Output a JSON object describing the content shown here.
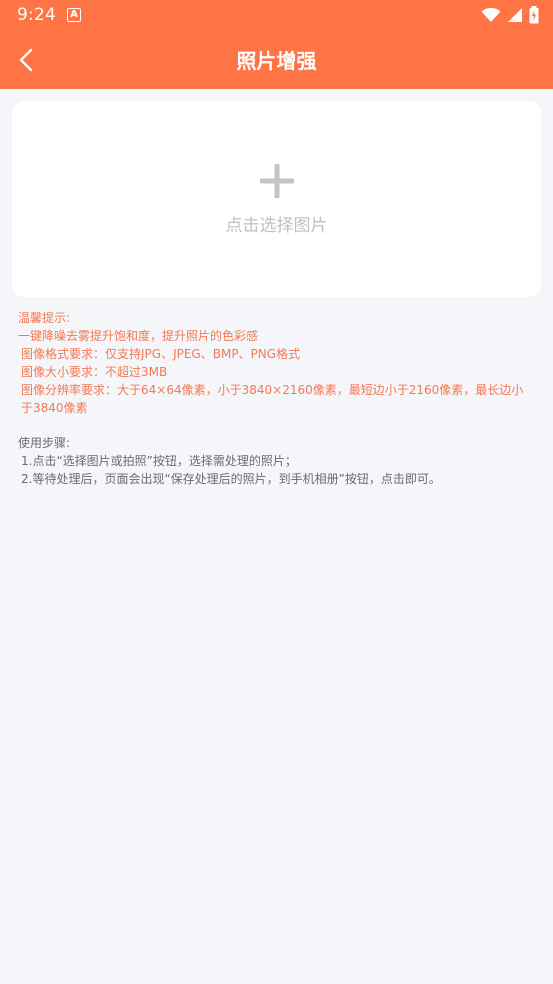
{
  "colors": {
    "accent": "#ff7444",
    "tip_text": "#f47953",
    "body_text": "#6b6b6b",
    "page_background": "#f5f6fa",
    "card_background": "#ffffff",
    "placeholder": "#c0c0c0"
  },
  "status_bar": {
    "time": "9:24",
    "notification_icon": "A",
    "icons": [
      "wifi-icon",
      "signal-icon",
      "battery-charging-icon"
    ]
  },
  "app_bar": {
    "back_icon": "back-arrow-icon",
    "title": "照片增强"
  },
  "upload": {
    "icon": "plus-icon",
    "label": "点击选择图片"
  },
  "tips": {
    "heading": "温馨提示:",
    "lines": [
      "一键降噪去雾提升饱和度，提升照片的色彩感",
      "图像格式要求：仅支持JPG、JPEG、BMP、PNG格式",
      "图像大小要求：不超过3MB",
      "图像分辨率要求：大于64×64像素，小于3840×2160像素，最短边小于2160像素，最长边小于3840像素"
    ]
  },
  "steps": {
    "heading": "使用步骤:",
    "items": [
      "1.点击“选择图片或拍照”按钮，选择需处理的照片；",
      "2.等待处理后，页面会出现“保存处理后的照片，到手机相册”按钮，点击即可。"
    ]
  }
}
